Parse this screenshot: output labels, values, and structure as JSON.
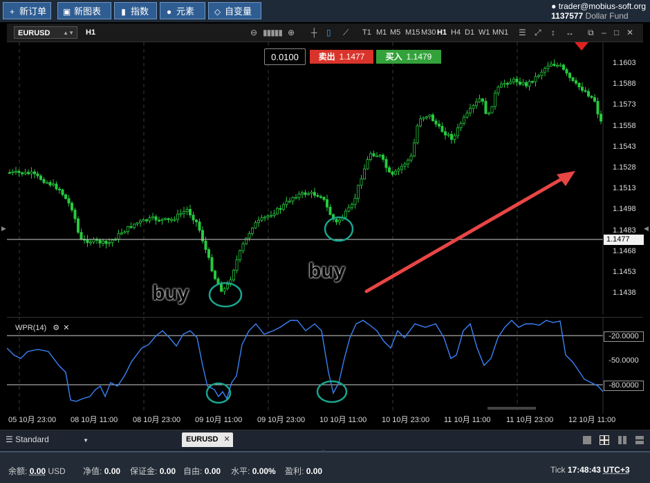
{
  "toolbar": {
    "new_order": "新订单",
    "new_chart": "新图表",
    "indicators": "指数",
    "elements": "元素",
    "variables": "自变量"
  },
  "account": {
    "email": "trader@mobius-soft.org",
    "number": "1137577",
    "name": "Dollar Fund"
  },
  "chart": {
    "symbol": "EURUSD",
    "timeframe_label": "H1",
    "timeframes": [
      "T1",
      "M1",
      "M5",
      "M15",
      "M30",
      "H1",
      "H4",
      "D1",
      "W1",
      "MN1"
    ],
    "active_timeframe": "H1",
    "price_labels": [
      "1.1603",
      "1.1588",
      "1.1573",
      "1.1558",
      "1.1543",
      "1.1528",
      "1.1513",
      "1.1498",
      "1.1483",
      "1.1468",
      "1.1453",
      "1.1438"
    ],
    "current_price": "1.1477",
    "time_labels": [
      "05 10月 23:00",
      "08 10月 11:00",
      "08 10月 23:00",
      "09 10月 11:00",
      "09 10月 23:00",
      "10 10月 11:00",
      "10 10月 23:00",
      "11 10月 11:00",
      "11 10月 23:00",
      "12 10月 11:00"
    ]
  },
  "trade": {
    "lot": "0.0100",
    "sell_label": "卖出",
    "sell_price": "1.1477",
    "buy_label": "买入",
    "buy_price": "1.1479"
  },
  "annotations": {
    "buy1": "buy",
    "buy2": "buy"
  },
  "indicator": {
    "title": "WPR(14)",
    "levels": [
      "-20.0000",
      "-50.0000",
      "-80.0000"
    ]
  },
  "tabs": {
    "layout": "Standard",
    "open_tab": "EURUSD"
  },
  "status": {
    "balance_label": "余额:",
    "balance_value": "0.00",
    "balance_currency": "USD",
    "equity_label": "净值:",
    "equity_value": "0.00",
    "margin_label": "保证金:",
    "margin_value": "0.00",
    "free_label": "自由:",
    "free_value": "0.00",
    "level_label": "水平:",
    "level_value": "0.00%",
    "profit_label": "盈利:",
    "profit_value": "0.00",
    "tick_label": "Tick",
    "time": "17:48:43",
    "tz": "UTC+3"
  },
  "colors": {
    "candle": "#27c93f",
    "wpr_line": "#3b82f6",
    "arrow": "#e84545",
    "circle": "#1aa58f",
    "sell": "#d9342b",
    "buy": "#34a23b"
  }
}
